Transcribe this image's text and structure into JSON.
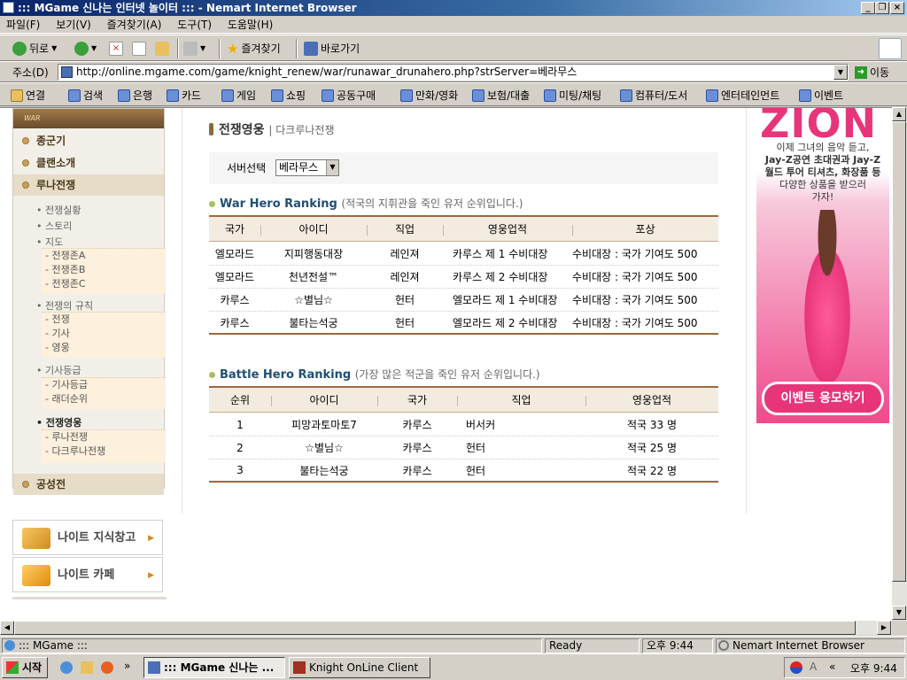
{
  "window": {
    "title": "::: MGame 신나는 인터넷 놀이터 ::: - Nemart Internet Browser",
    "controls": [
      "_",
      "❐",
      "×"
    ]
  },
  "menu": [
    "파일(F)",
    "보기(V)",
    "즐겨찾기(A)",
    "도구(T)",
    "도움말(H)"
  ],
  "toolbar": {
    "back": "뒤로",
    "favorites": "즐겨찾기",
    "goto": "바로가기"
  },
  "address": {
    "label": "주소(D)",
    "url": "http://online.mgame.com/game/knight_renew/war/runawar_drunahero.php?strServer=베라무스",
    "go": "이동"
  },
  "links": {
    "label": "연결",
    "items": [
      "검색",
      "은행",
      "카드",
      "게임",
      "쇼핑",
      "공동구매",
      "만화/영화",
      "보험/대출",
      "미팅/채팅",
      "컴퓨터/도서",
      "엔터테인먼트",
      "이벤트"
    ]
  },
  "sidebar": {
    "logo_text": "WAR",
    "categories": [
      "종군기",
      "클랜소개",
      "루나전쟁",
      "공성전"
    ],
    "subs": {
      "war_status": "• 전쟁실황",
      "story": "• 스토리",
      "map": "• 지도",
      "map_items": [
        "- 전쟁존A",
        "- 전쟁존B",
        "- 전쟁존C"
      ],
      "rules": "• 전쟁의 규칙",
      "rules_items": [
        "- 전쟁",
        "- 기사",
        "- 영웅"
      ],
      "knight_rank": "• 기사등급",
      "knight_items": [
        "- 기사등급",
        "- 래더순위"
      ],
      "war_hero": "• 전쟁영웅",
      "hero_items": [
        "- 루나전쟁",
        "- 다크루나전쟁"
      ]
    },
    "box1": "나이트 지식창고",
    "box2": "나이트 카페"
  },
  "page": {
    "heading": "전쟁영웅",
    "heading_sub": "| 다크루나전쟁",
    "server_label": "서버선택",
    "server_value": "베라무스"
  },
  "war_hero": {
    "title": "War Hero Ranking",
    "desc": "(적국의 지휘관을 죽인 유저 순위입니다.)",
    "headers": [
      "국가",
      "아이디",
      "직업",
      "영웅업적",
      "포상"
    ],
    "rows": [
      [
        "엘모라드",
        "지피행동대장",
        "레인져",
        "카루스 제 1 수비대장",
        "수비대장 : 국가 기여도 500"
      ],
      [
        "엘모라드",
        "천년전설™",
        "레인져",
        "카루스 제 2 수비대장",
        "수비대장 : 국가 기여도 500"
      ],
      [
        "카루스",
        "☆별님☆",
        "헌터",
        "엘모라드 제 1 수비대장",
        "수비대장 : 국가 기여도 500"
      ],
      [
        "카루스",
        "불타는석궁",
        "헌터",
        "엘모라드 제 2 수비대장",
        "수비대장 : 국가 기여도 500"
      ]
    ]
  },
  "battle_hero": {
    "title": "Battle Hero Ranking",
    "desc": "(가장 많은 적군을 죽인 유저 순위입니다.)",
    "headers": [
      "순위",
      "아이디",
      "국가",
      "직업",
      "영웅업적"
    ],
    "rows": [
      [
        "1",
        "피망과토마토7",
        "카루스",
        "버서커",
        "적국 33 명"
      ],
      [
        "2",
        "☆별님☆",
        "카루스",
        "헌터",
        "적국 25 명"
      ],
      [
        "3",
        "불타는석궁",
        "카루스",
        "헌터",
        "적국 22 명"
      ]
    ]
  },
  "ad": {
    "brand": "ZION",
    "line1": "이제 그녀의 음악 듣고,",
    "line2": "Jay-Z공연 초대권과 Jay-Z",
    "line3": "월드 투어 티셔츠, 화장품 등",
    "line4": "다양한 상품을 받으러",
    "line5": "가자!",
    "button": "이벤트 응모하기"
  },
  "status": {
    "left": "::: MGame :::",
    "state": "Ready",
    "time": "오후 9:44",
    "zone": "Nemart Internet Browser"
  },
  "taskbar": {
    "start": "시작",
    "task1": "::: MGame 신나는 ...",
    "task2": "Knight OnLine Client",
    "clock": "오후 9:44",
    "chev": "»",
    "lang": "«"
  },
  "colors": {
    "title_bar": "#0a246a",
    "table_header_bg": "#f3ebe0",
    "table_border": "#9a6a40",
    "section_title": "#1f4f72",
    "ad_bg": "#f04a8a",
    "ad_button": "#e8357a"
  }
}
